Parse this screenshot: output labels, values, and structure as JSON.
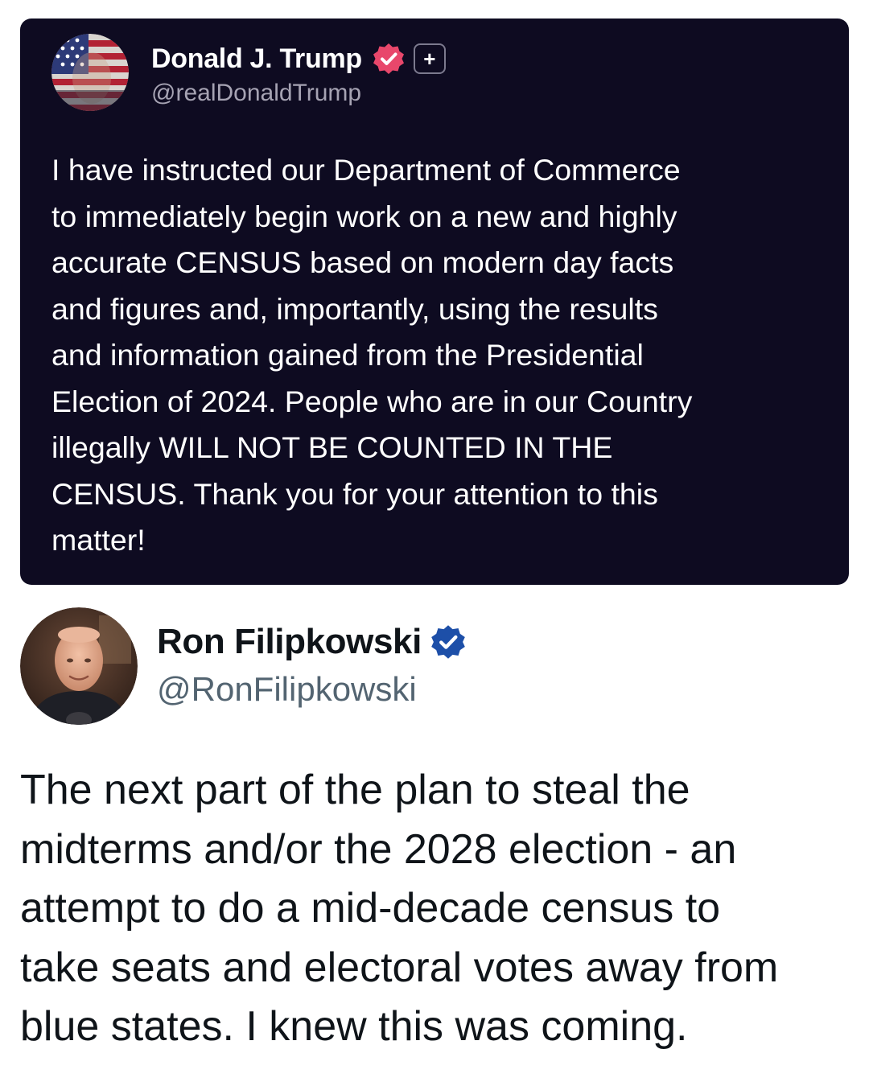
{
  "quoted_post": {
    "author_name": "Donald J. Trump",
    "author_handle": "@realDonaldTrump",
    "verified_badge": "pink-check-badge-icon",
    "plus_badge": "+",
    "body_lines": [
      "I have instructed our Department of Commerce",
      "to immediately begin work on a new and highly",
      "accurate CENSUS based on modern day facts",
      "and figures and, importantly, using the results",
      "and information gained from the Presidential",
      "Election of 2024. People who are in our Country",
      "illegally WILL NOT BE COUNTED IN THE",
      "CENSUS. Thank you for your attention to this",
      "matter!"
    ],
    "colors": {
      "background": "#0e0b21",
      "text": "#ffffff",
      "handle": "#a6a3b3",
      "badge": "#e8476b"
    }
  },
  "main_post": {
    "author_name": "Ron Filipkowski",
    "author_handle": "@RonFilipkowski",
    "verified_badge": "blue-check-badge-icon",
    "body_lines": [
      "The next part of the plan to steal the",
      "midterms and/or the 2028 election - an",
      "attempt to do a mid-decade census to",
      "take seats and electoral votes away from",
      "blue states. I knew this was coming."
    ],
    "colors": {
      "text": "#0f1419",
      "handle": "#536471",
      "badge": "#1d9bf0"
    }
  }
}
